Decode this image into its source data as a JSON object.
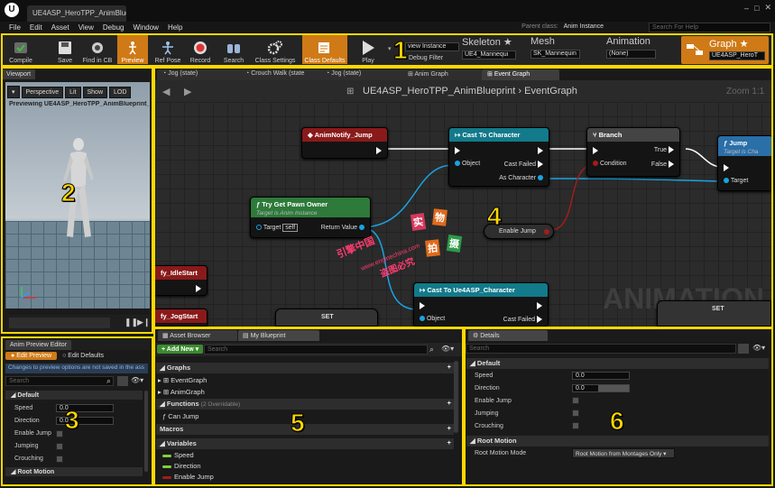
{
  "window": {
    "tab_title": "UE4ASP_HeroTPP_AnimBlue...",
    "logo": "U",
    "controls": [
      "–",
      "□",
      "✕"
    ]
  },
  "menu": [
    "File",
    "Edit",
    "Asset",
    "View",
    "Debug",
    "Window",
    "Help"
  ],
  "parent_class": {
    "label": "Parent class:",
    "value": "Anim Instance"
  },
  "help_search_placeholder": "Search For Help",
  "toolbar": {
    "buttons": [
      {
        "label": "Compile",
        "icon": "compile-icon"
      },
      {
        "label": "Save",
        "icon": "save-icon"
      },
      {
        "label": "Find in CB",
        "icon": "find-in-cb-icon"
      },
      {
        "label": "Preview",
        "icon": "preview-icon"
      },
      {
        "label": "Ref Pose",
        "icon": "ref-pose-icon"
      },
      {
        "label": "Record",
        "icon": "record-icon"
      },
      {
        "label": "Search",
        "icon": "binoculars-icon"
      },
      {
        "label": "Class Settings",
        "icon": "gears-icon"
      },
      {
        "label": "Class Defaults",
        "icon": "class-defaults-icon"
      },
      {
        "label": "Play",
        "icon": "play-icon"
      }
    ],
    "debug_select": "view Instance",
    "debug_filter": "Debug Filter",
    "modes": [
      {
        "label": "Skeleton",
        "value": "UE4_Mannequi"
      },
      {
        "label": "Mesh",
        "value": "SK_Mannequin"
      },
      {
        "label": "Animation",
        "value": "(None)"
      },
      {
        "label": "Graph",
        "value": "UE4ASP_HeroT"
      }
    ]
  },
  "viewport": {
    "tab": "Viewport",
    "buttons": [
      "Perspective",
      "Lit",
      "Show",
      "LOD"
    ],
    "previewing": "Previewing UE4ASP_HeroTPP_AnimBlueprint_C"
  },
  "anim_preview": {
    "tab": "Anim Preview Editor",
    "edit_preview": "Edit Preview",
    "edit_defaults": "Edit Defaults",
    "warning": "Changes to preview options are not saved in the ass",
    "search_placeholder": "Search",
    "category_default": "Default",
    "props": [
      {
        "label": "Speed",
        "value": "0.0"
      },
      {
        "label": "Direction",
        "value": "0.0"
      },
      {
        "label": "Enable Jump"
      },
      {
        "label": "Jumping"
      },
      {
        "label": "Crouching"
      }
    ],
    "category_root": "Root Motion"
  },
  "graph": {
    "tabs": [
      "Jog (state)",
      "Crouch Walk (state",
      "Jog (state)",
      "Anim Graph",
      "Event Graph"
    ],
    "breadcrumb": "UE4ASP_HeroTPP_AnimBlueprint  ›  EventGraph",
    "zoom": "Zoom 1:1",
    "watermark": "ANIMATION",
    "nodes": {
      "anim_notify_jump": "AnimNotify_Jump",
      "cast_to_character": {
        "title": "Cast To Character",
        "object": "Object",
        "cast_failed": "Cast Failed",
        "as_character": "As Character"
      },
      "branch": {
        "title": "Branch",
        "true": "True",
        "false": "False",
        "condition": "Condition"
      },
      "jump": {
        "title": "Jump",
        "sub": "Target is Cha",
        "target": "Target"
      },
      "try_get_pawn_owner": {
        "title": "Try Get Pawn Owner",
        "sub": "Target is Anim Instance",
        "target": "Target",
        "self": "self",
        "return_value": "Return Value"
      },
      "enable_jump": "Enable Jump",
      "idle_start": "fy_IdleStart",
      "jog_start": "fy_JogStart",
      "set": "SET",
      "set2": "SET",
      "cast_to_ue4asp": {
        "title": "Cast To Ue4ASP_Character",
        "object": "Object",
        "cast_failed": "Cast Failed"
      }
    },
    "overlay_text": [
      "实",
      "物",
      "拍",
      "摄",
      "引擎中国",
      "www.enginechina.com",
      "盗图必究"
    ]
  },
  "my_blueprint": {
    "tabs": [
      "Asset Browser",
      "My Blueprint"
    ],
    "add_new": "+ Add New ▾",
    "search_placeholder": "Search",
    "graphs_cat": "Graphs",
    "graphs": [
      "EventGraph",
      "AnimGraph"
    ],
    "functions_cat": "Functions",
    "functions_count": "(2 Overridable)",
    "functions": [
      "Can Jump"
    ],
    "macros_cat": "Macros",
    "variables_cat": "Variables",
    "variables": [
      {
        "name": "Speed",
        "color": "#7fd13b"
      },
      {
        "name": "Direction",
        "color": "#7fd13b"
      },
      {
        "name": "Enable Jump",
        "color": "#a31c1c"
      }
    ]
  },
  "details": {
    "tab": "Details",
    "search_placeholder": "Search",
    "default_cat": "Default",
    "props": [
      {
        "label": "Speed",
        "value": "0.0"
      },
      {
        "label": "Direction",
        "value": "0.0"
      },
      {
        "label": "Enable Jump"
      },
      {
        "label": "Jumping"
      },
      {
        "label": "Crouching"
      }
    ],
    "root_cat": "Root Motion",
    "root_motion_mode_label": "Root Motion Mode",
    "root_motion_mode_value": "Root Motion from Montages Only ▾"
  },
  "markers": [
    "1",
    "2",
    "3",
    "4",
    "5",
    "6"
  ],
  "colors": {
    "accent_orange": "#cf7a16",
    "marker_yellow": "#ffd800",
    "exec_white": "#ffffff",
    "object_blue": "#00a8f4",
    "bool_red": "#a31c1c"
  }
}
